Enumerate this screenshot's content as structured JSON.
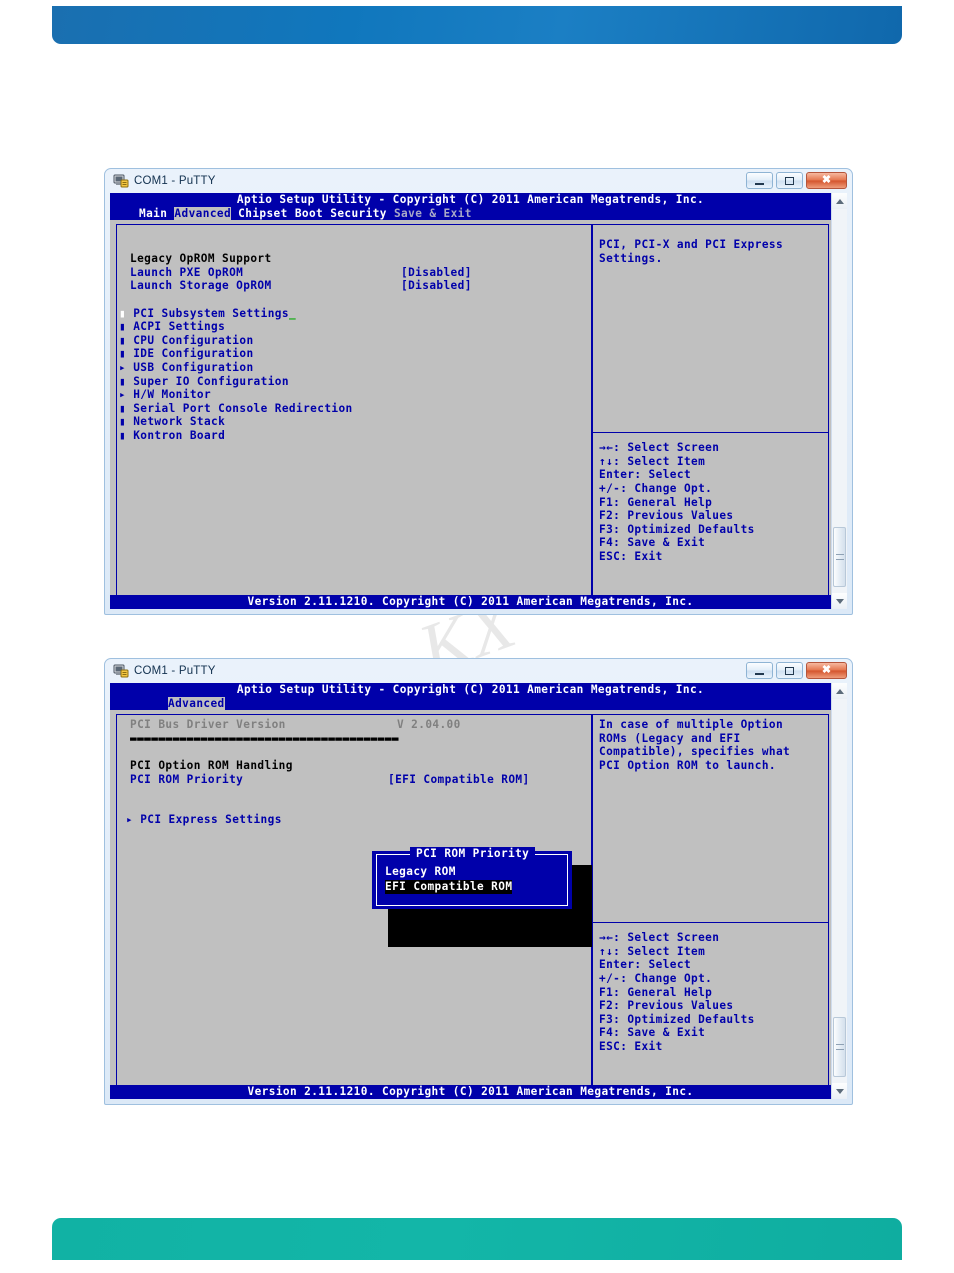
{
  "document": {
    "watermark_text": "KX"
  },
  "window1": {
    "title": "COM1 - PuTTY",
    "buttons": {
      "minimize": "–",
      "maximize": "▭",
      "close": "✕"
    },
    "bios": {
      "header": "Aptio Setup Utility - Copyright (C) 2011 American Megatrends, Inc.",
      "menu": [
        "Main",
        "Advanced",
        "Chipset",
        "Boot",
        "Security",
        "Save & Exit"
      ],
      "active_menu": "Advanced",
      "footer": "Version 2.11.1210. Copyright (C) 2011 American Megatrends, Inc.",
      "left_items": [
        {
          "label": "Legacy OpROM Support",
          "value": "",
          "style": "heading",
          "marker": ""
        },
        {
          "label": "Launch PXE OpROM",
          "value": "[Disabled]",
          "style": "option",
          "marker": ""
        },
        {
          "label": "Launch Storage OpROM",
          "value": "[Disabled]",
          "style": "option",
          "marker": ""
        },
        {
          "label": "",
          "value": "",
          "style": "blank",
          "marker": ""
        },
        {
          "label": "PCI Subsystem Settings",
          "value": "",
          "style": "selected",
          "marker": "▮"
        },
        {
          "label": "ACPI Settings",
          "value": "",
          "style": "submenu",
          "marker": "▮"
        },
        {
          "label": "CPU Configuration",
          "value": "",
          "style": "submenu",
          "marker": "▮"
        },
        {
          "label": "IDE Configuration",
          "value": "",
          "style": "submenu",
          "marker": "▮"
        },
        {
          "label": "USB Configuration",
          "value": "",
          "style": "submenu",
          "marker": "▸"
        },
        {
          "label": "Super IO Configuration",
          "value": "",
          "style": "submenu",
          "marker": "▮"
        },
        {
          "label": "H/W Monitor",
          "value": "",
          "style": "submenu",
          "marker": "▸"
        },
        {
          "label": "Serial Port Console Redirection",
          "value": "",
          "style": "submenu",
          "marker": "▮"
        },
        {
          "label": "Network Stack",
          "value": "",
          "style": "submenu",
          "marker": "▮"
        },
        {
          "label": "Kontron Board",
          "value": "",
          "style": "submenu",
          "marker": "▮"
        }
      ],
      "help_text": [
        "PCI, PCI-X and PCI Express",
        "Settings."
      ],
      "keys": [
        "→←: Select Screen",
        "↑↓: Select Item",
        "Enter: Select",
        "+/-: Change Opt.",
        "F1: General Help",
        "F2: Previous Values",
        "F3: Optimized Defaults",
        "F4: Save & Exit",
        "ESC: Exit"
      ]
    }
  },
  "window2": {
    "title": "COM1 - PuTTY",
    "buttons": {
      "minimize": "–",
      "maximize": "▭",
      "close": "✕"
    },
    "bios": {
      "header": "Aptio Setup Utility - Copyright (C) 2011 American Megatrends, Inc.",
      "menu": [
        "Advanced"
      ],
      "active_menu": "Advanced",
      "footer": "Version 2.11.1210. Copyright (C) 2011 American Megatrends, Inc.",
      "driver_label": "PCI Bus Driver Version",
      "driver_value": "V 2.04.00",
      "separator_blocks": "▬▬▬▬▬▬▬▬▬▬▬▬▬▬▬▬▬▬▬▬▬▬▬▬▬▬▬▬▬▬▬▬▬▬▬▬▬▬",
      "section_heading": "PCI Option ROM Handling",
      "rom_priority_label": "PCI ROM Priority",
      "rom_priority_value": "[EFI Compatible ROM]",
      "express_settings_label": "PCI Express Settings",
      "express_settings_marker": "▸",
      "help_text": [
        "In case of multiple Option",
        "ROMs (Legacy and EFI",
        "Compatible), specifies what",
        "PCI Option ROM to launch."
      ],
      "keys": [
        "→←: Select Screen",
        "↑↓: Select Item",
        "Enter: Select",
        "+/-: Change Opt.",
        "F1: General Help",
        "F2: Previous Values",
        "F3: Optimized Defaults",
        "F4: Save & Exit",
        "ESC: Exit"
      ],
      "popup": {
        "title": "PCI ROM Priority",
        "options": [
          "Legacy ROM",
          "EFI Compatible ROM"
        ],
        "selected": "EFI Compatible ROM"
      }
    }
  },
  "colors": {
    "bios_blue": "#0000aa",
    "bios_gray": "#c0c0c0",
    "banner_top": "#1077bd",
    "banner_bottom": "#12b3a5"
  }
}
